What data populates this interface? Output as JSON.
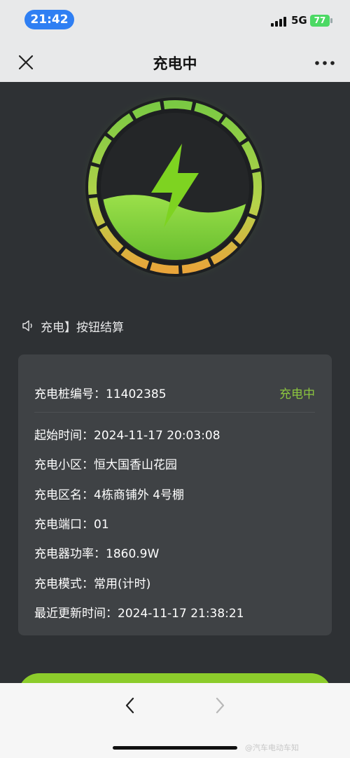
{
  "status_bar": {
    "time": "21:42",
    "network": "5G",
    "battery": "77"
  },
  "nav": {
    "title": "充电中",
    "close_icon": "close-icon",
    "more_icon": "more-icon"
  },
  "notice": {
    "icon": "speaker-icon",
    "text": "充电】按钮结算"
  },
  "info": {
    "status": "充电中",
    "rows": [
      {
        "label": "充电桩编号：",
        "value": "11402385"
      },
      {
        "label": "起始时间：",
        "value": "2024-11-17 20:03:08"
      },
      {
        "label": "充电小区：",
        "value": "恒大国香山花园"
      },
      {
        "label": "充电区名：",
        "value": "4栋商铺外 4号棚"
      },
      {
        "label": "充电端口：",
        "value": "01"
      },
      {
        "label": "充电器功率：",
        "value": "1860.9W"
      },
      {
        "label": "充电模式：",
        "value": "常用(计时)"
      },
      {
        "label": "最近更新时间：",
        "value": "2024-11-17 21:38:21"
      }
    ]
  },
  "bottom_nav": {
    "back_icon": "chevron-left-icon",
    "forward_icon": "chevron-right-icon",
    "watermark": "@汽车电动车知"
  },
  "colors": {
    "accent_green": "#8cc63f",
    "status_blue": "#2f7ff3",
    "background": "#2e3134",
    "card": "#3f4245"
  }
}
